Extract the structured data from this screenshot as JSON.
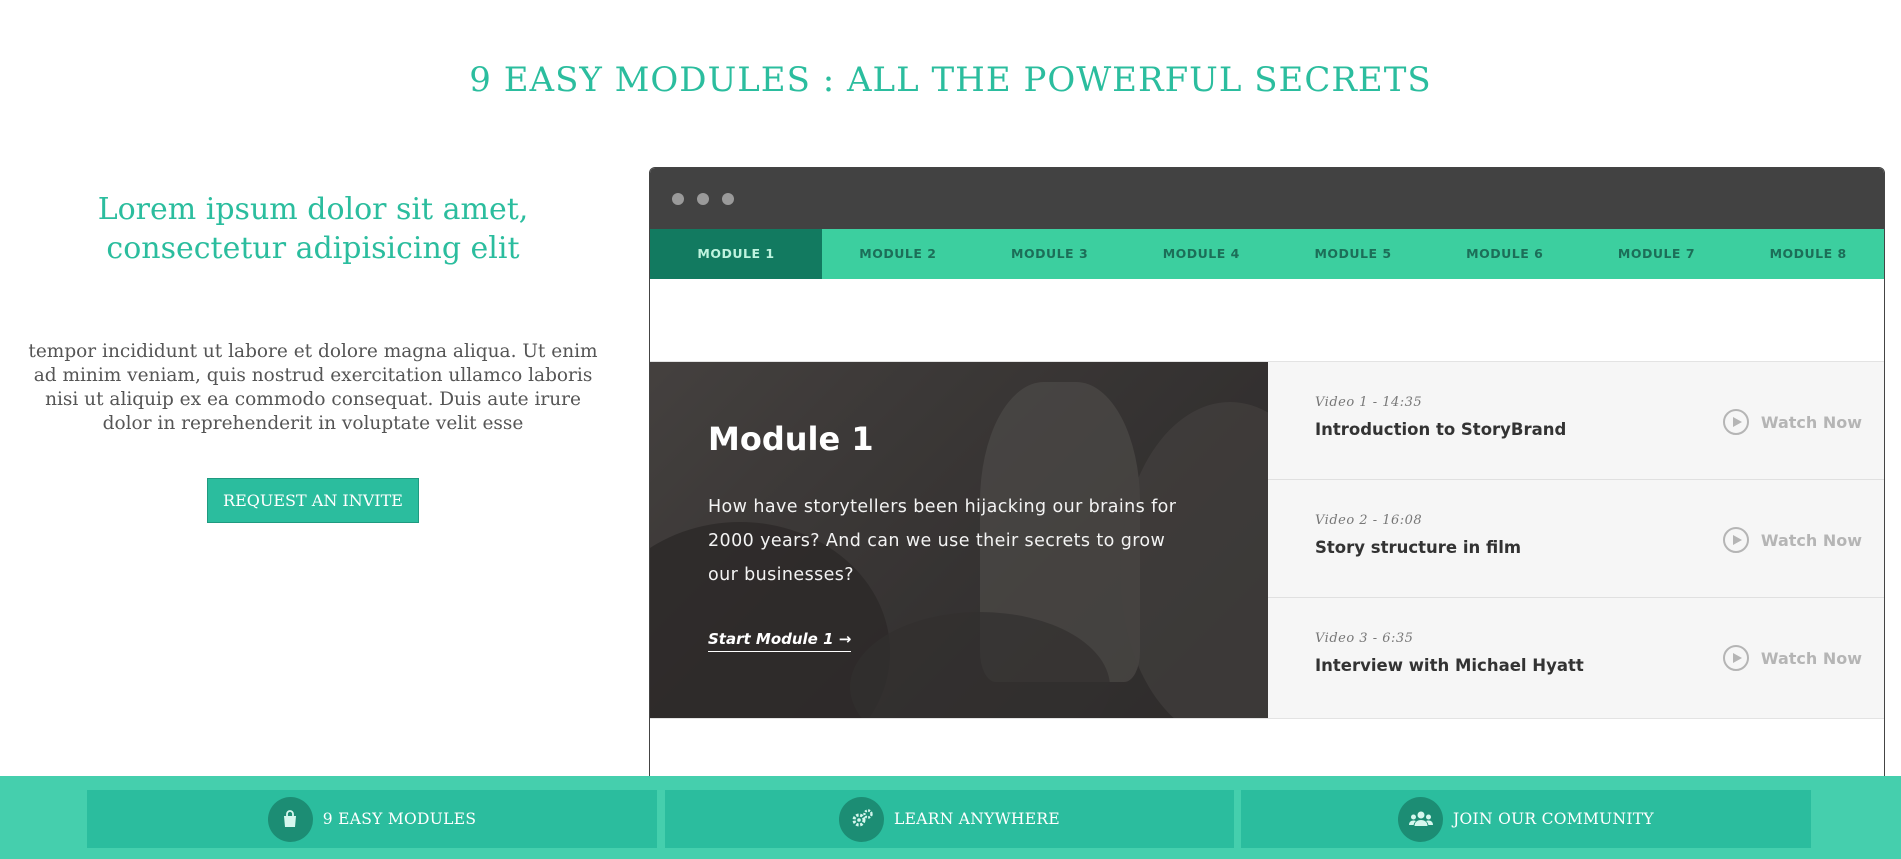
{
  "main_title": "9 EASY MODULES : ALL THE POWERFUL SECRETS",
  "left": {
    "heading": "Lorem ipsum dolor sit amet, consectetur adipisicing elit",
    "body": "tempor incididunt ut labore et dolore magna aliqua. Ut enim ad minim veniam, quis nostrud exercitation ullamco laboris nisi ut aliquip ex ea commodo consequat. Duis aute irure dolor in reprehenderit in voluptate velit esse",
    "button_label": "REQUEST AN INVITE"
  },
  "browser": {
    "tabs": [
      "MODULE 1",
      "MODULE 2",
      "MODULE 3",
      "MODULE 4",
      "MODULE 5",
      "MODULE 6",
      "MODULE 7",
      "MODULE 8"
    ],
    "active_tab": "MODULE 1",
    "hero": {
      "title": "Module 1",
      "description": "How have storytellers been hijacking our brains for 2000 years? And can we use their secrets to grow our businesses?",
      "link": "Start Module 1 →"
    },
    "videos": [
      {
        "meta": "Video 1 - 14:35",
        "title": "Introduction to StoryBrand",
        "action": "Watch Now"
      },
      {
        "meta": "Video 2 - 16:08",
        "title": "Story structure in film",
        "action": "Watch Now"
      },
      {
        "meta": "Video 3 - 6:35",
        "title": "Interview with Michael Hyatt",
        "action": "Watch Now"
      }
    ]
  },
  "features": [
    {
      "icon": "shopping-bag-icon",
      "label": "9 EASY MODULES"
    },
    {
      "icon": "gears-icon",
      "label": "LEARN ANYWHERE"
    },
    {
      "icon": "users-icon",
      "label": "JOIN OUR COMMUNITY"
    }
  ],
  "colors": {
    "accent": "#2bbd9e",
    "tab_bar": "#3ccf9f",
    "active_tab": "#127a60",
    "browser_chrome": "#424242",
    "feature_bar": "#45cfad"
  }
}
